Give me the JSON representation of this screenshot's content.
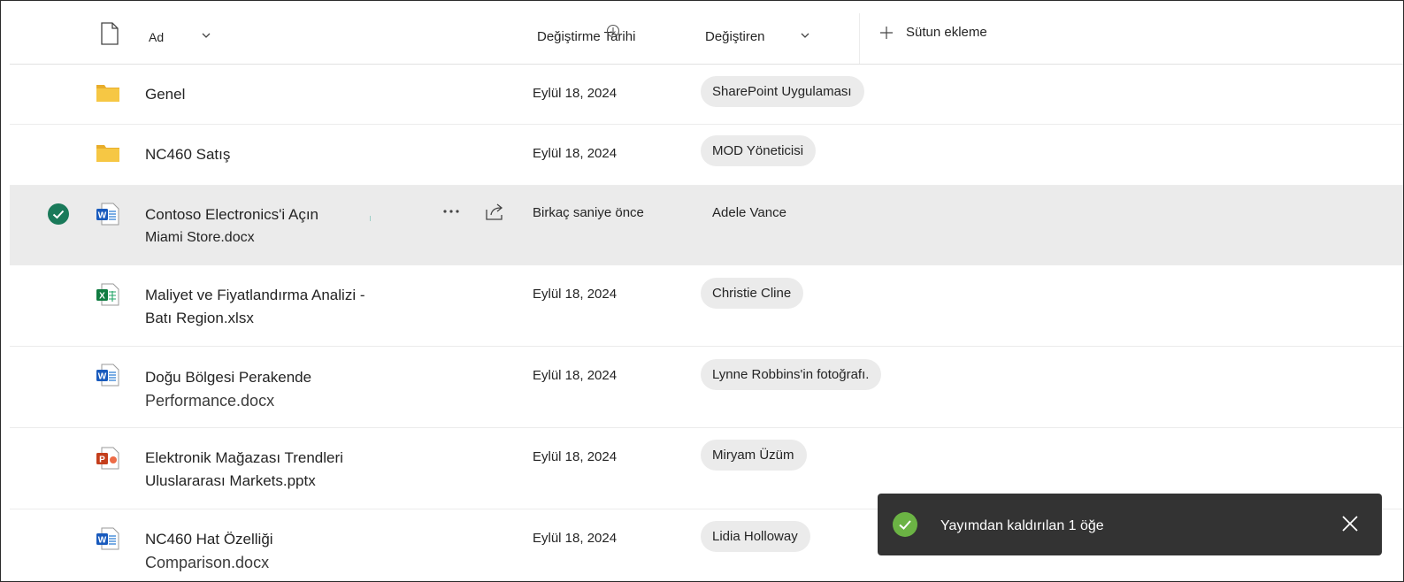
{
  "header": {
    "name_label": "Ad",
    "modified_label": "Değiştirme Tarihi",
    "modified_by_label": "Değiştiren",
    "add_column_label": "Sütun ekleme"
  },
  "rows": [
    {
      "type": "folder",
      "name_line1": "Genel",
      "name_line2": "",
      "date": "Eylül 18, 2024",
      "modified_by": "SharePoint Uygulaması"
    },
    {
      "type": "folder",
      "name_line1": "NC460 Satış",
      "name_line2": "",
      "date": "Eylül 18, 2024",
      "modified_by": "MOD Yöneticisi"
    },
    {
      "type": "word",
      "name_line1": "Contoso Electronics'i Açın",
      "name_line2": "Miami Store.docx",
      "date": "Birkaç saniye önce",
      "modified_by": "Adele Vance",
      "selected": true
    },
    {
      "type": "excel",
      "name_line1": "Maliyet ve Fiyatlandırma Analizi -",
      "name_line2": "Batı Region.xlsx",
      "date": "Eylül 18, 2024",
      "modified_by": "Christie Cline"
    },
    {
      "type": "word",
      "name_line1": "Doğu Bölgesi Perakende",
      "name_line2": "Performance.docx",
      "date": "Eylül 18, 2024",
      "modified_by": "Lynne Robbins'in fotoğrafı."
    },
    {
      "type": "powerpoint",
      "name_line1": "Elektronik Mağazası Trendleri",
      "name_line2": "Uluslararası Markets.pptx",
      "date": "Eylül 18, 2024",
      "modified_by": "Miryam  Üzüm"
    },
    {
      "type": "word",
      "name_line1": "NC460 Hat Özelliği",
      "name_line2": "Comparison.docx",
      "date": "Eylül 18, 2024",
      "modified_by": "Lidia Holloway"
    }
  ],
  "toast": {
    "message": "Yayımdan kaldırılan 1 öğe"
  },
  "icons": {
    "file_header": "file-icon",
    "folder": "folder-icon",
    "word": "word-file-icon",
    "excel": "excel-file-icon",
    "powerpoint": "powerpoint-file-icon",
    "selected_check": "check-circle-icon",
    "more": "more-icon",
    "share": "share-icon",
    "add": "plus-icon",
    "close": "close-icon"
  },
  "colors": {
    "folder": "#f6c744",
    "word": "#185abd",
    "excel": "#107c41",
    "powerpoint": "#c43e1c",
    "selected_check": "#1a7a5a",
    "toast_bg": "#333333",
    "toast_check": "#6bb344"
  }
}
